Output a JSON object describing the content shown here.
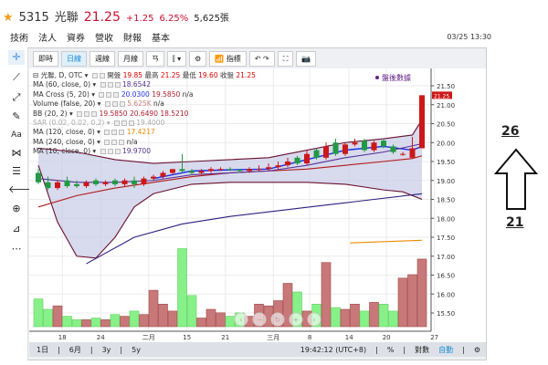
{
  "header": {
    "code": "5315",
    "name": "光聯",
    "price": "21.25",
    "change": "+1.25",
    "change_pct": "6.25%",
    "volume": "5,625張"
  },
  "tabs": [
    "技術",
    "法人",
    "資券",
    "營收",
    "財報",
    "基本"
  ],
  "datetime": "03/25 13:30",
  "toolbar": [
    "即時",
    "日線",
    "週線",
    "月線",
    "ㄢ",
    "指標"
  ],
  "legend": {
    "title": "光聯, D, OTC",
    "open_label": "開盤",
    "open": "19.85",
    "high_label": "最高",
    "high": "21.25",
    "low_label": "最低",
    "low": "19.60",
    "close_label": "收盤",
    "close": "21.25",
    "rows": [
      {
        "name": "MA (60, close, 0)",
        "vals": "18.6542",
        "color": "#553399"
      },
      {
        "name": "MA Cross (5, 20)",
        "vals": "20.0300",
        "vals2": "19.5850",
        "vals3": "n/a",
        "color": "#2233ee"
      },
      {
        "name": "Volume (false, 20)",
        "vals": "5.625K",
        "vals3": "n/a",
        "color": "#d08080"
      },
      {
        "name": "BB (20, 2)",
        "vals": "19.5850 20.6490 18.5210",
        "color": "#b02030"
      },
      {
        "name": "SAR (0.02, 0.02, 0.2)",
        "vals": "19.4000",
        "color": "#aaa"
      },
      {
        "name": "MA (120, close, 0)",
        "vals": "17.4217",
        "color": "#f08a00"
      },
      {
        "name": "MA (240, close, 0)",
        "vals": "n/a",
        "color": "#333"
      },
      {
        "name": "MA (10, close, 0)",
        "vals": "19.9700",
        "color": "#553399"
      }
    ]
  },
  "after_hours": "盤後數據",
  "last_price_tag": "21.25",
  "y_ticks": [
    "21.50",
    "21.00",
    "20.50",
    "20.00",
    "19.50",
    "19.00",
    "18.50",
    "18.00",
    "17.50",
    "17.00",
    "16.50",
    "16.00",
    "15.50"
  ],
  "x_ticks": [
    {
      "l": "18",
      "i": 2.5
    },
    {
      "l": "24",
      "i": 6.5
    },
    {
      "l": "二月",
      "i": 11.5
    },
    {
      "l": "15",
      "i": 15.5
    },
    {
      "l": "21",
      "i": 19.5
    },
    {
      "l": "三月",
      "i": 24.5
    },
    {
      "l": "8",
      "i": 28.3
    },
    {
      "l": "14",
      "i": 32.4
    },
    {
      "l": "20",
      "i": 36.3
    },
    {
      "l": "27",
      "i": 41.3
    }
  ],
  "bottom_bar": {
    "ranges": [
      "1日",
      "6月",
      "3y",
      "5y"
    ],
    "clock": "19:42:12 (UTC+8)",
    "pct": "%",
    "log": "對數",
    "auto": "自動"
  },
  "annotations": {
    "top": "26",
    "bottom": "21"
  },
  "chart_data": {
    "type": "candlestick",
    "ylim": [
      15.2,
      21.75
    ],
    "candles": [
      [
        19.2,
        19.3,
        18.9,
        18.95
      ],
      [
        18.95,
        19.1,
        18.75,
        18.8
      ],
      [
        18.8,
        19.0,
        18.75,
        18.95
      ],
      [
        19.0,
        19.1,
        18.8,
        18.85
      ],
      [
        18.9,
        19.0,
        18.8,
        18.85
      ],
      [
        18.85,
        19.0,
        18.8,
        18.95
      ],
      [
        19.0,
        19.05,
        18.85,
        18.9
      ],
      [
        18.9,
        19.0,
        18.85,
        18.95
      ],
      [
        19.0,
        19.05,
        18.85,
        18.9
      ],
      [
        18.9,
        19.05,
        18.85,
        19.0
      ],
      [
        19.0,
        19.1,
        18.8,
        18.9
      ],
      [
        18.9,
        19.1,
        18.85,
        19.05
      ],
      [
        19.05,
        19.15,
        19.0,
        19.1
      ],
      [
        19.1,
        19.25,
        19.05,
        19.2
      ],
      [
        19.2,
        19.3,
        19.15,
        19.3
      ],
      [
        19.3,
        19.7,
        19.2,
        19.25
      ],
      [
        19.25,
        19.3,
        19.15,
        19.2
      ],
      [
        19.2,
        19.3,
        19.15,
        19.25
      ],
      [
        19.25,
        19.35,
        19.2,
        19.3
      ],
      [
        19.3,
        19.35,
        19.25,
        19.3
      ],
      [
        19.3,
        19.35,
        19.25,
        19.28
      ],
      [
        19.28,
        19.3,
        19.2,
        19.25
      ],
      [
        19.25,
        19.35,
        19.2,
        19.3
      ],
      [
        19.3,
        19.4,
        19.25,
        19.3
      ],
      [
        19.3,
        19.45,
        19.25,
        19.35
      ],
      [
        19.35,
        19.5,
        19.3,
        19.4
      ],
      [
        19.4,
        19.6,
        19.35,
        19.5
      ],
      [
        19.6,
        19.65,
        19.4,
        19.45
      ],
      [
        19.45,
        19.8,
        19.4,
        19.7
      ],
      [
        19.8,
        19.85,
        19.55,
        19.6
      ],
      [
        19.6,
        20.0,
        19.55,
        19.9
      ],
      [
        20.0,
        20.1,
        19.65,
        19.7
      ],
      [
        19.7,
        20.0,
        19.65,
        19.95
      ],
      [
        19.95,
        20.1,
        19.9,
        20.0
      ],
      [
        20.05,
        20.1,
        19.75,
        19.8
      ],
      [
        19.8,
        20.05,
        19.75,
        20.0
      ],
      [
        20.05,
        20.1,
        19.85,
        19.9
      ],
      [
        19.9,
        19.95,
        19.7,
        19.75
      ],
      [
        19.7,
        19.75,
        19.65,
        19.7
      ],
      [
        19.6,
        20.15,
        19.6,
        19.85
      ],
      [
        19.85,
        21.25,
        19.85,
        21.25
      ]
    ],
    "volumes": [
      1.6,
      1.0,
      1.2,
      0.6,
      0.4,
      0.4,
      0.5,
      0.4,
      0.7,
      0.6,
      0.9,
      0.7,
      2.1,
      1.3,
      0.9,
      4.5,
      1.8,
      0.5,
      1.0,
      0.8,
      0.6,
      0.8,
      0.6,
      1.3,
      1.2,
      1.5,
      2.5,
      2.0,
      0.9,
      1.3,
      3.7,
      1.1,
      1.0,
      1.3,
      0.9,
      1.4,
      1.3,
      0.9,
      2.8,
      3.0,
      3.9
    ],
    "vol_max": 5.0,
    "lines": [
      {
        "name": "BB upper",
        "color": "#6a1030",
        "pts": [
          [
            0,
            19.85
          ],
          [
            4,
            19.75
          ],
          [
            8,
            19.55
          ],
          [
            12,
            19.45
          ],
          [
            16,
            19.5
          ],
          [
            20,
            19.55
          ],
          [
            24,
            19.6
          ],
          [
            28,
            19.8
          ],
          [
            32,
            20.0
          ],
          [
            36,
            20.1
          ],
          [
            39,
            20.2
          ],
          [
            40,
            20.6
          ]
        ]
      },
      {
        "name": "BB lower",
        "color": "#6a1030",
        "pts": [
          [
            0,
            19.4
          ],
          [
            2,
            17.9
          ],
          [
            4,
            17.0
          ],
          [
            6,
            16.95
          ],
          [
            8,
            17.5
          ],
          [
            10,
            18.3
          ],
          [
            12,
            18.65
          ],
          [
            16,
            18.9
          ],
          [
            20,
            18.95
          ],
          [
            24,
            18.95
          ],
          [
            28,
            18.95
          ],
          [
            32,
            18.9
          ],
          [
            36,
            18.75
          ],
          [
            38,
            18.7
          ],
          [
            40,
            18.5
          ]
        ]
      },
      {
        "name": "BB mid",
        "color": "#b01818",
        "pts": [
          [
            0,
            18.3
          ],
          [
            4,
            18.6
          ],
          [
            8,
            18.8
          ],
          [
            12,
            18.95
          ],
          [
            16,
            19.1
          ],
          [
            20,
            19.2
          ],
          [
            24,
            19.25
          ],
          [
            28,
            19.3
          ],
          [
            32,
            19.4
          ],
          [
            36,
            19.5
          ],
          [
            39,
            19.58
          ],
          [
            40,
            19.65
          ]
        ]
      },
      {
        "name": "MA5",
        "color": "#1a2ee6",
        "pts": [
          [
            12,
            19.05
          ],
          [
            16,
            19.25
          ],
          [
            20,
            19.28
          ],
          [
            24,
            19.3
          ],
          [
            28,
            19.55
          ],
          [
            32,
            19.8
          ],
          [
            36,
            19.9
          ],
          [
            39,
            19.8
          ],
          [
            40,
            19.9
          ]
        ]
      },
      {
        "name": "MA60",
        "color": "#2a2080",
        "pts": [
          [
            5,
            16.8
          ],
          [
            10,
            17.5
          ],
          [
            15,
            17.85
          ],
          [
            20,
            18.05
          ],
          [
            25,
            18.2
          ],
          [
            30,
            18.35
          ],
          [
            35,
            18.5
          ],
          [
            40,
            18.65
          ]
        ]
      },
      {
        "name": "MA10",
        "color": "#553399",
        "pts": [
          [
            0,
            19.05
          ],
          [
            4,
            18.95
          ],
          [
            8,
            18.95
          ],
          [
            12,
            19.0
          ],
          [
            16,
            19.15
          ],
          [
            20,
            19.2
          ],
          [
            24,
            19.25
          ],
          [
            28,
            19.4
          ],
          [
            32,
            19.6
          ],
          [
            36,
            19.75
          ],
          [
            40,
            19.97
          ]
        ]
      },
      {
        "name": "MA120",
        "color": "#f08a00",
        "pts": [
          [
            32.5,
            17.35
          ],
          [
            40,
            17.42
          ]
        ]
      }
    ]
  }
}
